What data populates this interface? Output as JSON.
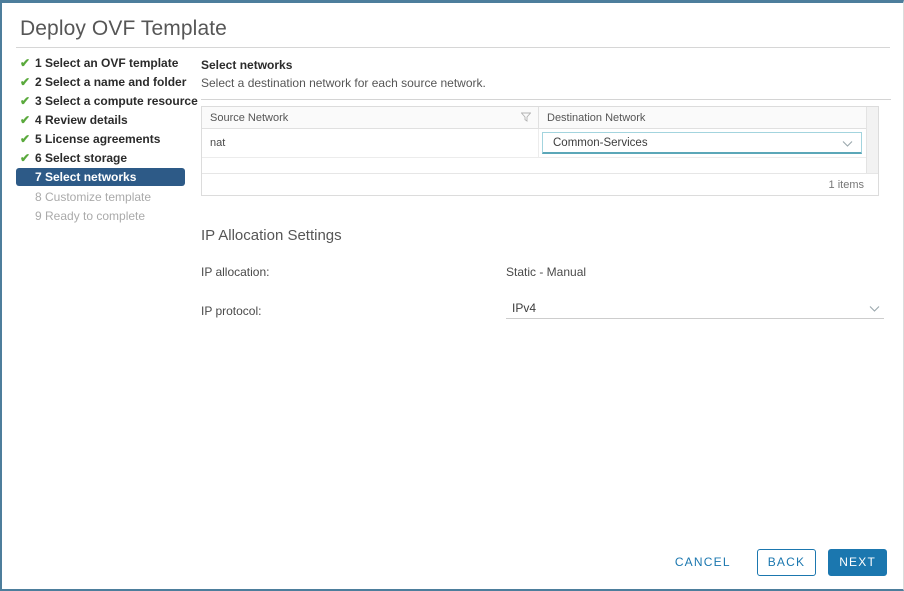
{
  "window": {
    "title": "Deploy OVF Template",
    "accent_border": "#4d7e9c"
  },
  "sidebar": {
    "steps": [
      {
        "number": "1",
        "label": "1 Select an OVF template",
        "state": "done",
        "check": "✔"
      },
      {
        "number": "2",
        "label": "2 Select a name and folder",
        "state": "done",
        "check": "✔"
      },
      {
        "number": "3",
        "label": "3 Select a compute resource",
        "state": "done",
        "check": "✔"
      },
      {
        "number": "4",
        "label": "4 Review details",
        "state": "done",
        "check": "✔"
      },
      {
        "number": "5",
        "label": "5 License agreements",
        "state": "done",
        "check": "✔"
      },
      {
        "number": "6",
        "label": "6 Select storage",
        "state": "done",
        "check": "✔"
      },
      {
        "number": "7",
        "label": "7 Select networks",
        "state": "current",
        "check": ""
      },
      {
        "number": "8",
        "label": "8 Customize template",
        "state": "pending",
        "check": ""
      },
      {
        "number": "9",
        "label": "9 Ready to complete",
        "state": "pending",
        "check": ""
      }
    ],
    "current_color": "#2d5a87",
    "check_color": "#5aa93c"
  },
  "pane": {
    "title": "Select networks",
    "subtitle": "Select a destination network for each source network."
  },
  "grid": {
    "columns": {
      "source": "Source Network",
      "destination": "Destination Network"
    },
    "filter_icon": "filter-icon",
    "rows": [
      {
        "source": "nat",
        "destination_selected": "Common-Services"
      }
    ],
    "footer_count": "1 items",
    "select_border": "#a3d4de"
  },
  "ip_allocation": {
    "section_title": "IP Allocation Settings",
    "allocation_label": "IP allocation:",
    "allocation_value": "Static - Manual",
    "protocol_label": "IP protocol:",
    "protocol_value": "IPv4"
  },
  "footer": {
    "cancel_label": "CANCEL",
    "back_label": "BACK",
    "next_label": "NEXT",
    "primary_color": "#1b77af"
  }
}
